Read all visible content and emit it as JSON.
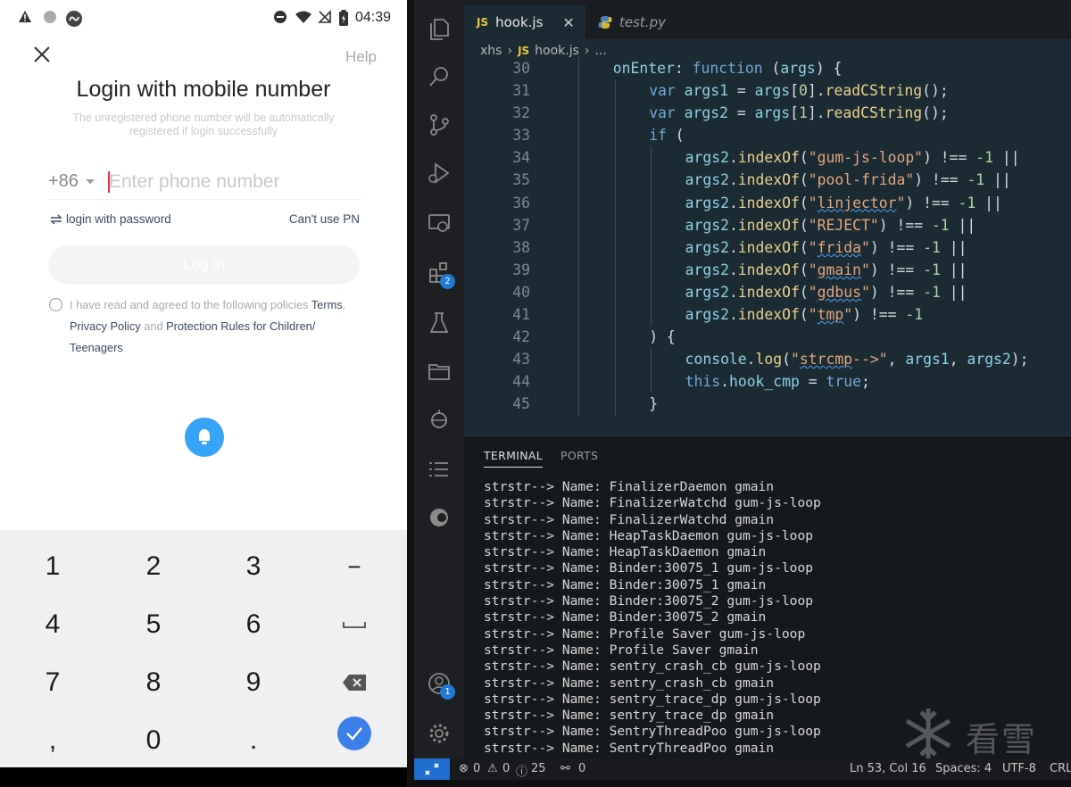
{
  "phone": {
    "status": {
      "time": "04:39",
      "icons": [
        "warning-icon",
        "circle-icon",
        "app-badge-icon",
        "dnd-icon",
        "wifi-icon",
        "no-sim-icon",
        "battery-icon"
      ]
    },
    "help": "Help",
    "title": "Login with mobile number",
    "subtitle": "The unregistered phone number will be automatically registered if login successfully",
    "country_code": "+86",
    "phone_placeholder": "Enter phone number",
    "login_with_password": "login with password",
    "cant_use_pn": "Can't use PN",
    "login_button": "Log in",
    "policy": {
      "prefix": "I have read and agreed to the following policies ",
      "terms": "Terms",
      "comma": ", ",
      "privacy": "Privacy Policy",
      "and": " and ",
      "children": "Protection Rules for Children/ Teenagers"
    },
    "keypad": [
      "1",
      "2",
      "3",
      "−",
      "4",
      "5",
      "6",
      "␣",
      "7",
      "8",
      "9",
      "⌫",
      ",",
      "0",
      ".",
      "✓"
    ]
  },
  "vscode": {
    "tabs": [
      {
        "label": "hook.js",
        "icon": "JS",
        "active": true
      },
      {
        "label": "test.py",
        "icon": "python",
        "active": false
      }
    ],
    "breadcrumb": [
      "xhs",
      "hook.js",
      "..."
    ],
    "code_lines": [
      {
        "n": "30",
        "indent": 2
      },
      {
        "n": "31",
        "indent": 3
      },
      {
        "n": "32",
        "indent": 3
      },
      {
        "n": "33",
        "indent": 3
      },
      {
        "n": "34",
        "indent": 4,
        "s": "gum-js-loop"
      },
      {
        "n": "35",
        "indent": 4,
        "s": "pool-frida"
      },
      {
        "n": "36",
        "indent": 4,
        "s": "linjector"
      },
      {
        "n": "37",
        "indent": 4,
        "s": "REJECT"
      },
      {
        "n": "38",
        "indent": 4,
        "s": "frida"
      },
      {
        "n": "39",
        "indent": 4,
        "s": "gmain"
      },
      {
        "n": "40",
        "indent": 4,
        "s": "gdbus"
      },
      {
        "n": "41",
        "indent": 4,
        "s": "tmp"
      },
      {
        "n": "42",
        "indent": 3
      },
      {
        "n": "43",
        "indent": 4
      },
      {
        "n": "44",
        "indent": 4
      },
      {
        "n": "45",
        "indent": 3
      }
    ],
    "panel_tabs": [
      "TERMINAL",
      "PORTS"
    ],
    "terminal_lines": [
      "strstr--> Name: FinalizerDaemon gmain",
      "strstr--> Name: FinalizerWatchd gum-js-loop",
      "strstr--> Name: FinalizerWatchd gmain",
      "strstr--> Name: HeapTaskDaemon gum-js-loop",
      "strstr--> Name: HeapTaskDaemon gmain",
      "strstr--> Name: Binder:30075_1 gum-js-loop",
      "strstr--> Name: Binder:30075_1 gmain",
      "strstr--> Name: Binder:30075_2 gum-js-loop",
      "strstr--> Name: Binder:30075_2 gmain",
      "strstr--> Name: Profile Saver gum-js-loop",
      "strstr--> Name: Profile Saver gmain",
      "strstr--> Name: sentry_crash_cb gum-js-loop",
      "strstr--> Name: sentry_crash_cb gmain",
      "strstr--> Name: sentry_trace_dp gum-js-loop",
      "strstr--> Name: sentry_trace_dp gmain",
      "strstr--> Name: SentryThreadPoo gum-js-loop",
      "strstr--> Name: SentryThreadPoo gmain"
    ],
    "status": {
      "errors": "0",
      "warnings": "0",
      "info": "25",
      "ports": "0",
      "position": "Ln 53, Col 16",
      "spaces": "Spaces: 4",
      "encoding": "UTF-8",
      "eol": "CRL"
    },
    "badges": {
      "extensions": "2",
      "accounts": "1"
    },
    "watermark": "看雪",
    "colors": {
      "accent": "#1f6fd1",
      "editor_bg": "#1b2b34",
      "string": "#e5a67d",
      "keyword": "#6fa8dc"
    }
  }
}
